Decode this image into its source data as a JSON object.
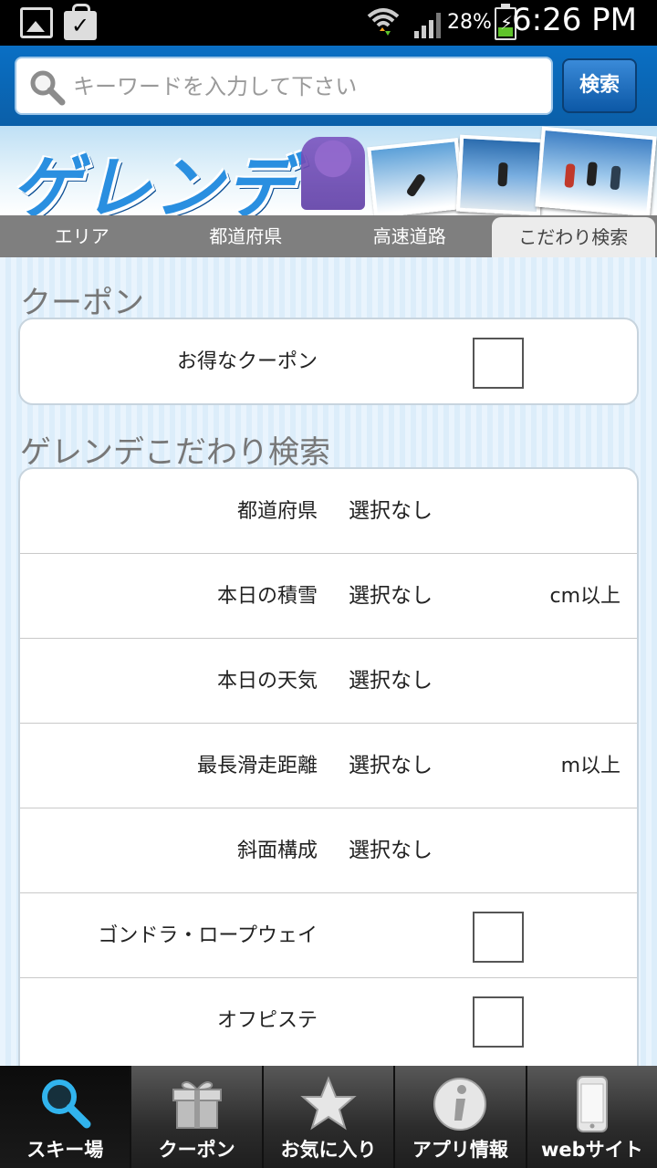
{
  "status_bar": {
    "battery": "28%",
    "time": "6:26 PM"
  },
  "search": {
    "placeholder": "キーワードを入力して下さい",
    "button_label": "検索"
  },
  "banner": {
    "title": "ゲレンデ"
  },
  "tabs": [
    {
      "label": "エリア",
      "active": false
    },
    {
      "label": "都道府県",
      "active": false
    },
    {
      "label": "高速道路",
      "active": false
    },
    {
      "label": "こだわり検索",
      "active": true
    }
  ],
  "coupon_section": {
    "title": "クーポン",
    "row_label": "お得なクーポン",
    "checked": false
  },
  "filter_section": {
    "title": "ゲレンデこだわり検索",
    "rows": [
      {
        "label": "都道府県",
        "value": "選択なし",
        "unit": ""
      },
      {
        "label": "本日の積雪",
        "value": "選択なし",
        "unit": "cm以上"
      },
      {
        "label": "本日の天気",
        "value": "選択なし",
        "unit": ""
      },
      {
        "label": "最長滑走距離",
        "value": "選択なし",
        "unit": "m以上"
      },
      {
        "label": "斜面構成",
        "value": "選択なし",
        "unit": ""
      },
      {
        "label": "ゴンドラ・ロープウェイ",
        "checked": false
      },
      {
        "label": "オフピステ",
        "checked": false
      }
    ]
  },
  "bottom_nav": [
    {
      "label": "スキー場",
      "icon": "magnifier-icon",
      "active": true
    },
    {
      "label": "クーポン",
      "icon": "gift-icon",
      "active": false
    },
    {
      "label": "お気に入り",
      "icon": "star-icon",
      "active": false
    },
    {
      "label": "アプリ情報",
      "icon": "info-icon",
      "active": false
    },
    {
      "label": "webサイト",
      "icon": "phone-icon",
      "active": false
    }
  ],
  "colors": {
    "header_blue": "#0b5fa8",
    "tab_gray": "#7f7f7f",
    "content_bg": "#e8f3fc",
    "nav_dark": "#2a2a2a",
    "accent_cyan": "#31b4ee"
  }
}
